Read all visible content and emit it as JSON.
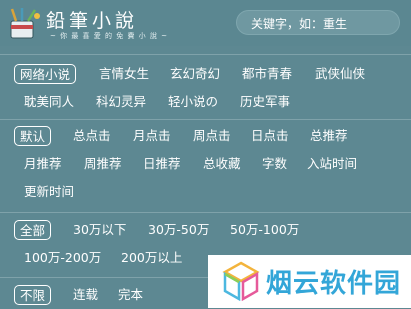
{
  "header": {
    "logo_title": "鉛筆小說",
    "logo_subtitle": "~ 你 最 喜 愛 的 免 費 小 說 ~",
    "search_placeholder": "关键字，如：重生"
  },
  "filters": {
    "category": {
      "selected": "网络小说",
      "options": [
        "网络小说",
        "言情女生",
        "玄幻奇幻",
        "都市青春",
        "武侠仙侠",
        "耽美同人",
        "科幻灵异",
        "轻小说の",
        "历史军事"
      ]
    },
    "sort": {
      "selected": "默认",
      "options": [
        "默认",
        "总点击",
        "月点击",
        "周点击",
        "日点击",
        "总推荐",
        "月推荐",
        "周推荐",
        "日推荐",
        "总收藏",
        "字数",
        "入站时间",
        "更新时间"
      ]
    },
    "length": {
      "selected": "全部",
      "options": [
        "全部",
        "30万以下",
        "30万-50万",
        "50万-100万",
        "100万-200万",
        "200万以上"
      ]
    },
    "status": {
      "selected": "不限",
      "options": [
        "不限",
        "连载",
        "完本"
      ]
    }
  },
  "watermark": {
    "text": "烟云软件园"
  },
  "colors": {
    "background": "#5d8892",
    "divider": "#7fa2aa",
    "watermark_text": "#33a6d8"
  }
}
